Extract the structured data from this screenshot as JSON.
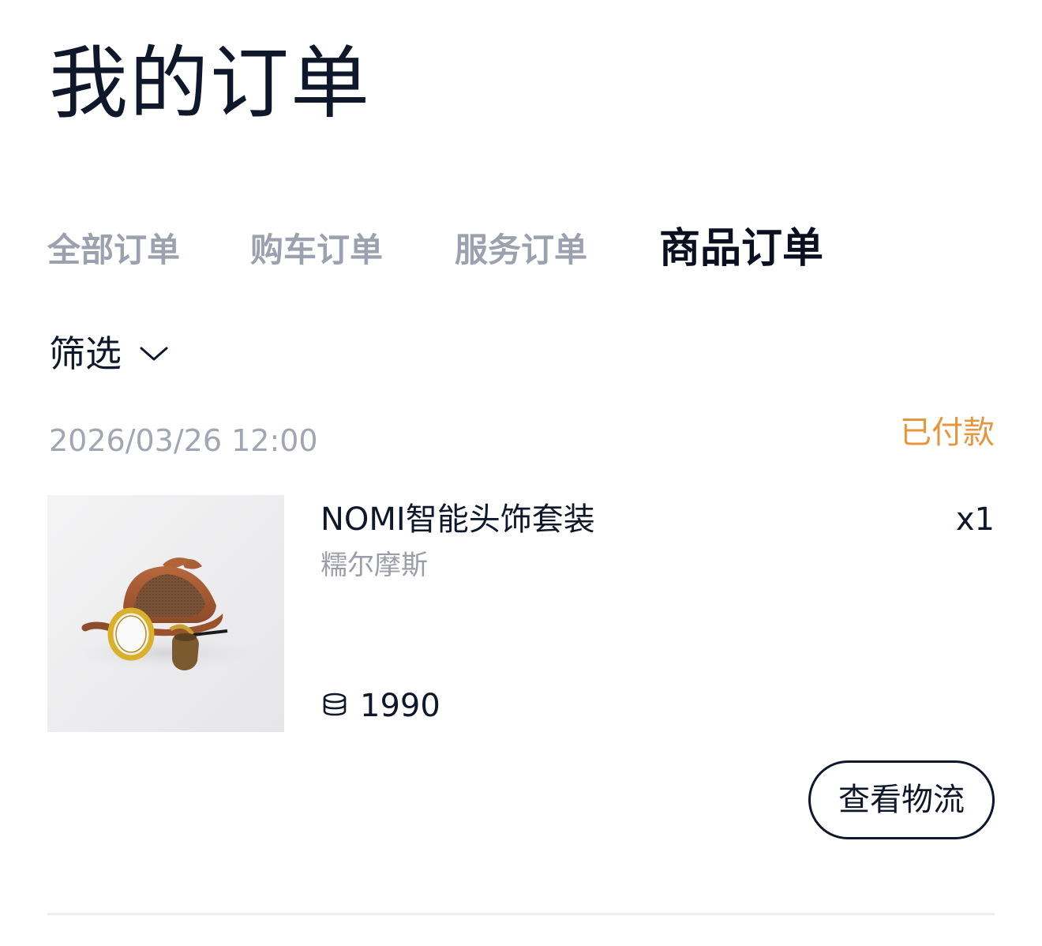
{
  "page": {
    "title": "我的订单"
  },
  "tabs": [
    {
      "label": "全部订单",
      "active": false
    },
    {
      "label": "购车订单",
      "active": false
    },
    {
      "label": "服务订单",
      "active": false
    },
    {
      "label": "商品订单",
      "active": true
    }
  ],
  "filter": {
    "label": "筛选",
    "icon": "chevron-down-icon"
  },
  "orders": [
    {
      "time": "2026/03/26 12:00",
      "status": "已付款",
      "status_color": "#e8963e",
      "product": {
        "name": "NOMI智能头饰套装",
        "variant": "糯尔摩斯",
        "quantity": "x1",
        "price_icon": "coin-stack-icon",
        "price": "1990"
      },
      "action_label": "查看物流"
    }
  ]
}
